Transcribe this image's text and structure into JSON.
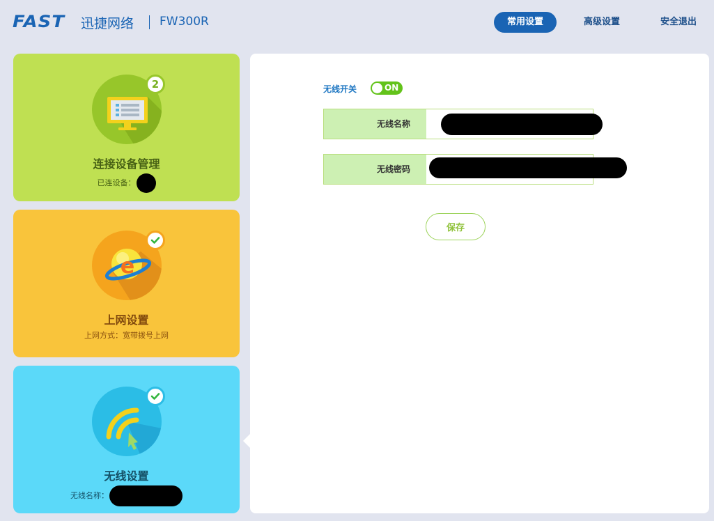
{
  "header": {
    "brand": "FAST",
    "brand_cn": "迅捷网络",
    "model": "FW300R",
    "nav": [
      {
        "label": "常用设置",
        "active": true
      },
      {
        "label": "高级设置",
        "active": false
      },
      {
        "label": "安全退出",
        "active": false
      }
    ]
  },
  "cards": {
    "devices": {
      "title": "连接设备管理",
      "subtitle": "已连设备：",
      "badge": "2",
      "badge_icon": "count-badge",
      "icon": "monitor-icon",
      "color": "#bfe052"
    },
    "internet": {
      "title": "上网设置",
      "subtitle": "上网方式：宽带拨号上网",
      "badge_icon": "check-icon",
      "icon": "globe-e-icon",
      "color": "#f9c43b"
    },
    "wireless": {
      "title": "无线设置",
      "subtitle": "无线名称：",
      "badge_icon": "check-icon",
      "icon": "wifi-icon",
      "color": "#5bd9f9"
    }
  },
  "wireless_form": {
    "switch_label": "无线开关",
    "switch_state": "ON",
    "ssid_label": "无线名称",
    "ssid_value": "",
    "password_label": "无线密码",
    "password_value": "",
    "save_label": "保存"
  },
  "colors": {
    "brand_blue": "#1a64b4",
    "toggle_on": "#63c31a",
    "field_border": "#b9de7e",
    "field_label_bg": "#cdf0b3"
  }
}
